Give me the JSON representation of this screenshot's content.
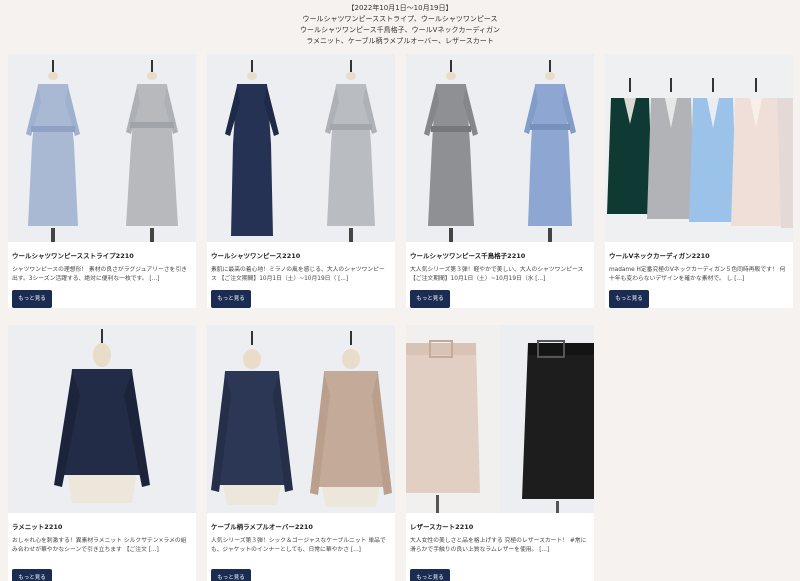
{
  "header": {
    "line1": "【2022年10月1日～10月19日】",
    "line2": "ウールシャツワンピースストライプ、ウールシャツワンピース",
    "line3": "ウールシャツワンピース千鳥格子、ウールVネックカーディガン",
    "line4": "ラメニット、ケーブル柄ラメプルオーバー、レザースカート"
  },
  "more_label": "もっと見る",
  "products": [
    {
      "title": "ウールシャツワンピースストライプ2210",
      "desc": "シャツワンピースの理想形！ 素材の良さがラグジュアリーさを引き出す。3シーズン活躍する、絶対に便利な一枚です。 [...]"
    },
    {
      "title": "ウールシャツワンピース2210",
      "desc": "素肌に最高の着心地！ミラノの風を感じる、大人のシャツワンピース 【ご注文期間】10月1日（土）~10月19日（ [...]"
    },
    {
      "title": "ウールシャツワンピース千鳥格子2210",
      "desc": "大人気シリーズ第３弾！軽やかで美しい、大人のシャツワンピース 【ご注文期間】10月1日（土）~10月19日（水 [...]"
    },
    {
      "title": "ウールVネックカーディガン2210",
      "desc": "madame H定番究極のVネックカーディガン５色同時再販です！ 何十年も変わらないデザインを確かな素材で。 し [...]"
    },
    {
      "title": "ラメニット2210",
      "desc": "おしゃれ心を刺激する！異素材ラメニット シルクサテン×ラメの組み合わせが華やかなシーンで引き立ちます 【ご注文 [...]"
    },
    {
      "title": "ケーブル柄ラメプルオーバー2210",
      "desc": "人気シリーズ第３弾！シック＆ゴージャスなケーブルニット 単品でも、ジャケットのインナーとしても、日常に華やかさ [...]"
    },
    {
      "title": "レザースカート2210",
      "desc": "大人女性の美しさと品を格上げする 究極のレザースカート！ #常に滑らかで手触りの良い上質なラムレザーを使用。 [...]"
    }
  ],
  "image_labels": {
    "dress": "dress-on-mannequin",
    "cardigan": "cardigans-on-mannequins",
    "knit": "knit-on-mannequin",
    "skirt": "skirts-on-mannequins"
  },
  "colors": {
    "button": "#1a2c52",
    "blue_stripe": "#a9b9d4",
    "grey_stripe": "#b7b9bd",
    "navy": "#253253",
    "light_grey": "#b9bcc1",
    "houndstooth": "#8e9094",
    "chambray": "#8da6d2",
    "beige": "#c4ab99",
    "pink_beige": "#e2cfc4",
    "black": "#1d1d1d"
  }
}
